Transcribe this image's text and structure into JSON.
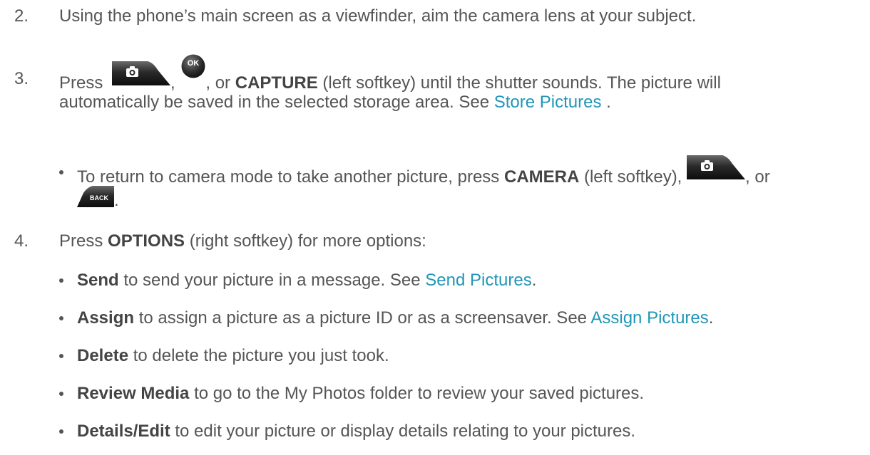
{
  "step2": {
    "num": "2.",
    "text": "Using the phone’s main screen as a viewfinder, aim the camera lens at your subject."
  },
  "step3": {
    "num": "3.",
    "press": "Press",
    "comma1": ",",
    "comma2": ", or",
    "capture": "CAPTURE",
    "capture_suffix": "(left softkey) until the shutter sounds. The picture will automatically be saved in the selected storage area. See",
    "link": "Store Pictures",
    "end": "."
  },
  "bullet_camera": {
    "pre": "To return to camera mode to take another picture, press",
    "camera": "CAMERA",
    "mid": "(left softkey),",
    "or": ", or",
    "end": "."
  },
  "step4": {
    "num": "4.",
    "press": "Press",
    "options": "OPTIONS",
    "rest": "(right softkey) for more options:"
  },
  "options": [
    {
      "term": "Send",
      "desc": "to send your picture in a message. See",
      "link": "Send Pictures",
      "end": "."
    },
    {
      "term": "Assign",
      "desc": "to assign a picture as a picture ID or as a screensaver. See",
      "link": "Assign Pictures",
      "end": "."
    },
    {
      "term": "Delete",
      "desc": "to delete the picture you just took."
    },
    {
      "term": "Review Media",
      "desc": "to go to the My Photos folder to review your saved pictures."
    },
    {
      "term": "Details/Edit",
      "desc": "to edit your picture or display details relating to your pictures."
    }
  ],
  "icons": {
    "ok_label": "OK",
    "back_label": "BACK",
    "key_color": "#1a1a1a",
    "key_highlight": "#5a5a5a"
  }
}
